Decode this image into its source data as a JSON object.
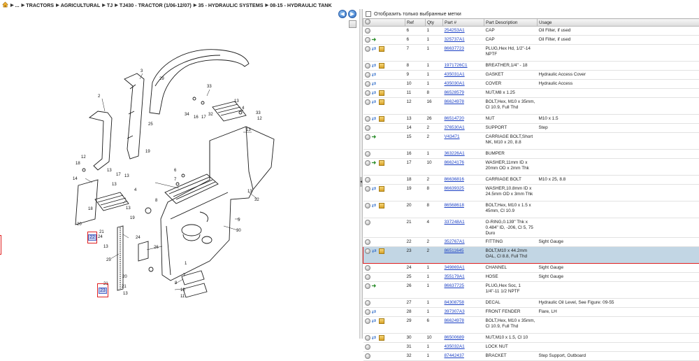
{
  "breadcrumb": [
    "...",
    "TRACTORS",
    "AGRICULTURAL",
    "TJ",
    "TJ430 - TRACTOR (1/06-12/07)",
    "35 - HYDRAULIC SYSTEMS",
    "08-15 - HYDRAULIC TANK"
  ],
  "nav": {
    "back_glyph": "◀",
    "forward_glyph": "▶"
  },
  "drawing": {
    "callouts": [
      {
        "text": "22"
      },
      {
        "text": "23"
      }
    ],
    "ref_labels": [
      "1",
      "2",
      "3",
      "4",
      "5",
      "6",
      "7",
      "8",
      "9",
      "10",
      "11",
      "12",
      "13",
      "14",
      "15",
      "16",
      "17",
      "18",
      "19",
      "20",
      "21",
      "24",
      "25",
      "26",
      "27",
      "28",
      "29",
      "30",
      "31",
      "32",
      "33",
      "34"
    ]
  },
  "filter": {
    "label": "Отобразить только выбранные метки",
    "checked": false
  },
  "table": {
    "headers": [
      "",
      "Ref",
      "Qty",
      "Part #",
      "Part Description",
      "Usage"
    ],
    "rows": [
      {
        "icons": [
          "info"
        ],
        "ref": "6",
        "qty": "1",
        "part": "254253A1",
        "desc": "CAP",
        "usage": "Oil Filter, if used"
      },
      {
        "icons": [
          "info",
          "sub"
        ],
        "ref": "6",
        "qty": "1",
        "part": "325737A1",
        "desc": "CAP",
        "usage": "Oil Filter, if used"
      },
      {
        "icons": [
          "info",
          "link",
          "box"
        ],
        "ref": "7",
        "qty": "1",
        "part": "86637723",
        "desc": "PLUG,Hex Hd, 1/2\"-14 NPTF",
        "usage": ""
      },
      {
        "icons": [
          "info",
          "link",
          "box"
        ],
        "ref": "8",
        "qty": "1",
        "part": "1971726C1",
        "desc": "BREATHER,1/4\" - 18",
        "usage": ""
      },
      {
        "icons": [
          "info",
          "link"
        ],
        "ref": "9",
        "qty": "1",
        "part": "435031A1",
        "desc": "GASKET",
        "usage": "Hydraulic Access Cover"
      },
      {
        "icons": [
          "info",
          "link"
        ],
        "ref": "10",
        "qty": "1",
        "part": "435030A1",
        "desc": "COVER",
        "usage": "Hydraulic Access"
      },
      {
        "icons": [
          "info",
          "link",
          "box"
        ],
        "ref": "11",
        "qty": "8",
        "part": "86528579",
        "desc": "NUT,M8 x 1.25",
        "usage": ""
      },
      {
        "icons": [
          "info",
          "link",
          "box"
        ],
        "ref": "12",
        "qty": "16",
        "part": "86624978",
        "desc": "BOLT,Hex, M10 x 35mm, Cl 10.9, Full Thd",
        "usage": ""
      },
      {
        "icons": [
          "info",
          "link",
          "box"
        ],
        "ref": "13",
        "qty": "26",
        "part": "86514720",
        "desc": "NUT",
        "usage": "M10 x 1.5"
      },
      {
        "icons": [
          "info"
        ],
        "ref": "14",
        "qty": "2",
        "part": "376530A1",
        "desc": "SUPPORT",
        "usage": "Step"
      },
      {
        "icons": [
          "info",
          "sub"
        ],
        "ref": "15",
        "qty": "2",
        "part": "V43471",
        "desc": "CARRIAGE BOLT,Short NK, M10 x 20, 8.8",
        "usage": ""
      },
      {
        "icons": [
          "info"
        ],
        "ref": "16",
        "qty": "1",
        "part": "363226A1",
        "desc": "BUMPER",
        "usage": ""
      },
      {
        "icons": [
          "info",
          "sub",
          "box"
        ],
        "ref": "17",
        "qty": "10",
        "part": "86624176",
        "desc": "WASHER,11mm ID x 20mm OD x 2mm Thk",
        "usage": ""
      },
      {
        "icons": [
          "info"
        ],
        "ref": "18",
        "qty": "2",
        "part": "86636816",
        "desc": "CARRIAGE BOLT",
        "usage": "M10 x 25, 8.8"
      },
      {
        "icons": [
          "info",
          "link",
          "box"
        ],
        "ref": "19",
        "qty": "8",
        "part": "86639325",
        "desc": "WASHER,10.8mm ID x 24.5mm OD x 3mm Thk",
        "usage": ""
      },
      {
        "icons": [
          "info",
          "link",
          "box"
        ],
        "ref": "20",
        "qty": "8",
        "part": "86568618",
        "desc": "BOLT,Hex, M10 x 1.5 x 45mm, Cl 10.9",
        "usage": ""
      },
      {
        "icons": [
          "info"
        ],
        "ref": "21",
        "qty": "4",
        "part": "337248A1",
        "desc": "O-RING,0.139\" Thk x 0.484\" ID, -206, Cl 5, 75 Duro",
        "usage": ""
      },
      {
        "icons": [
          "info"
        ],
        "ref": "22",
        "qty": "2",
        "part": "352767A1",
        "desc": "FITTING",
        "usage": "Sight Gauge"
      },
      {
        "icons": [
          "info",
          "link",
          "box"
        ],
        "ref": "23",
        "qty": "2",
        "part": "86511645",
        "desc": "BOLT,M10 x 44.2mm OAL, Cl 8.8, Full Thd",
        "usage": "",
        "selected": true
      },
      {
        "icons": [
          "info"
        ],
        "ref": "24",
        "qty": "1",
        "part": "349869A1",
        "desc": "CHANNEL",
        "usage": "Sight Gauge"
      },
      {
        "icons": [
          "info"
        ],
        "ref": "25",
        "qty": "1",
        "part": "355179A1",
        "desc": "HOSE",
        "usage": "Sight Gauge"
      },
      {
        "icons": [
          "info",
          "sub"
        ],
        "ref": "26",
        "qty": "1",
        "part": "86637725",
        "desc": "PLUG,Hex Soc, 1 1/4\"-11 1/2 NPTF",
        "usage": ""
      },
      {
        "icons": [
          "info"
        ],
        "ref": "27",
        "qty": "1",
        "part": "84308758",
        "desc": "DECAL",
        "usage": "Hydraulic Oil Level, See Figure: 09-55"
      },
      {
        "icons": [
          "info",
          "link"
        ],
        "ref": "28",
        "qty": "1",
        "part": "397307A3",
        "desc": "FRONT FENDER",
        "usage": "Flare, LH"
      },
      {
        "icons": [
          "info",
          "link",
          "box"
        ],
        "ref": "29",
        "qty": "6",
        "part": "86624978",
        "desc": "BOLT,Hex, M10 x 35mm, Cl 10.9, Full Thd",
        "usage": ""
      },
      {
        "icons": [
          "info",
          "link",
          "box"
        ],
        "ref": "30",
        "qty": "10",
        "part": "86500689",
        "desc": "NUT,M10 x 1.5, Cl 10",
        "usage": ""
      },
      {
        "icons": [
          "info"
        ],
        "ref": "31",
        "qty": "1",
        "part": "435032A1",
        "desc": "LOCK NUT",
        "usage": ""
      },
      {
        "icons": [
          "info"
        ],
        "ref": "32",
        "qty": "1",
        "part": "87442437",
        "desc": "BRACKET",
        "usage": "Step Support, Outboard"
      }
    ]
  }
}
